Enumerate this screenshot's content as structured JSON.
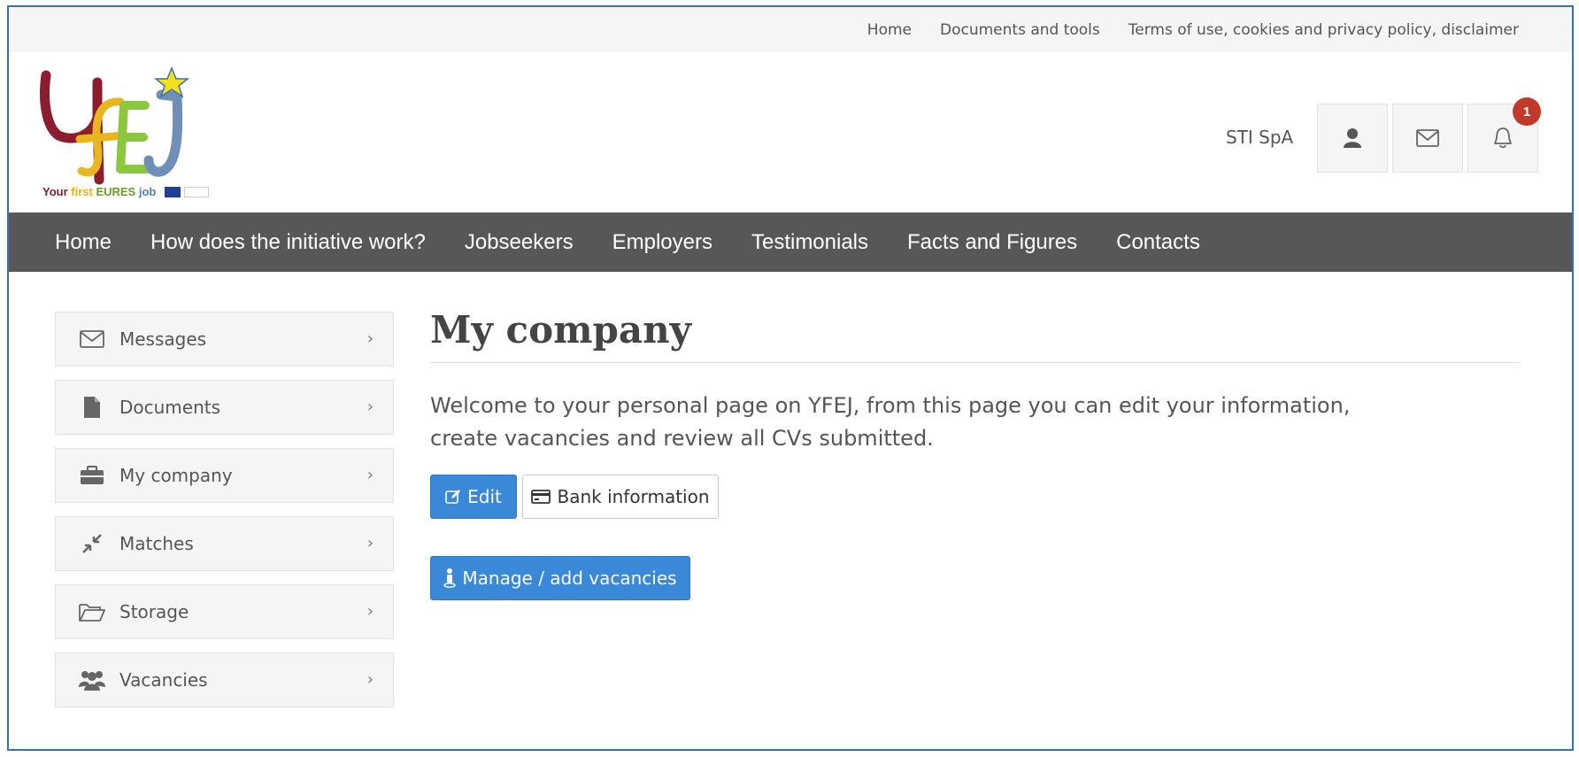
{
  "topbar": {
    "links": [
      "Home",
      "Documents and tools",
      "Terms of use, cookies and privacy policy, disclaimer"
    ]
  },
  "header": {
    "logo_tagline": {
      "part1": "Your ",
      "part2": "first ",
      "part3": "EURES ",
      "part4": "job"
    },
    "company_name": "STI SpA",
    "notification_count": "1",
    "icons": [
      "user-icon",
      "envelope-icon",
      "bell-icon"
    ]
  },
  "nav": {
    "items": [
      "Home",
      "How does the initiative work?",
      "Jobseekers",
      "Employers",
      "Testimonials",
      "Facts and Figures",
      "Contacts"
    ]
  },
  "sidebar": {
    "items": [
      {
        "label": "Messages",
        "icon": "envelope-icon"
      },
      {
        "label": "Documents",
        "icon": "file-icon"
      },
      {
        "label": "My company",
        "icon": "briefcase-icon"
      },
      {
        "label": "Matches",
        "icon": "compress-icon"
      },
      {
        "label": "Storage",
        "icon": "folder-open-icon"
      },
      {
        "label": "Vacancies",
        "icon": "users-icon"
      }
    ],
    "chevron": "›"
  },
  "main": {
    "title": "My company",
    "intro": "Welcome to your personal page on YFEJ, from this page you can edit your information, create vacancies and review all CVs submitted.",
    "edit_label": "Edit",
    "bank_label": "Bank information",
    "manage_label": "Manage / add vacancies"
  },
  "colors": {
    "accent": "#3a88d8",
    "nav_bg": "#575757",
    "badge": "#c0392b"
  }
}
